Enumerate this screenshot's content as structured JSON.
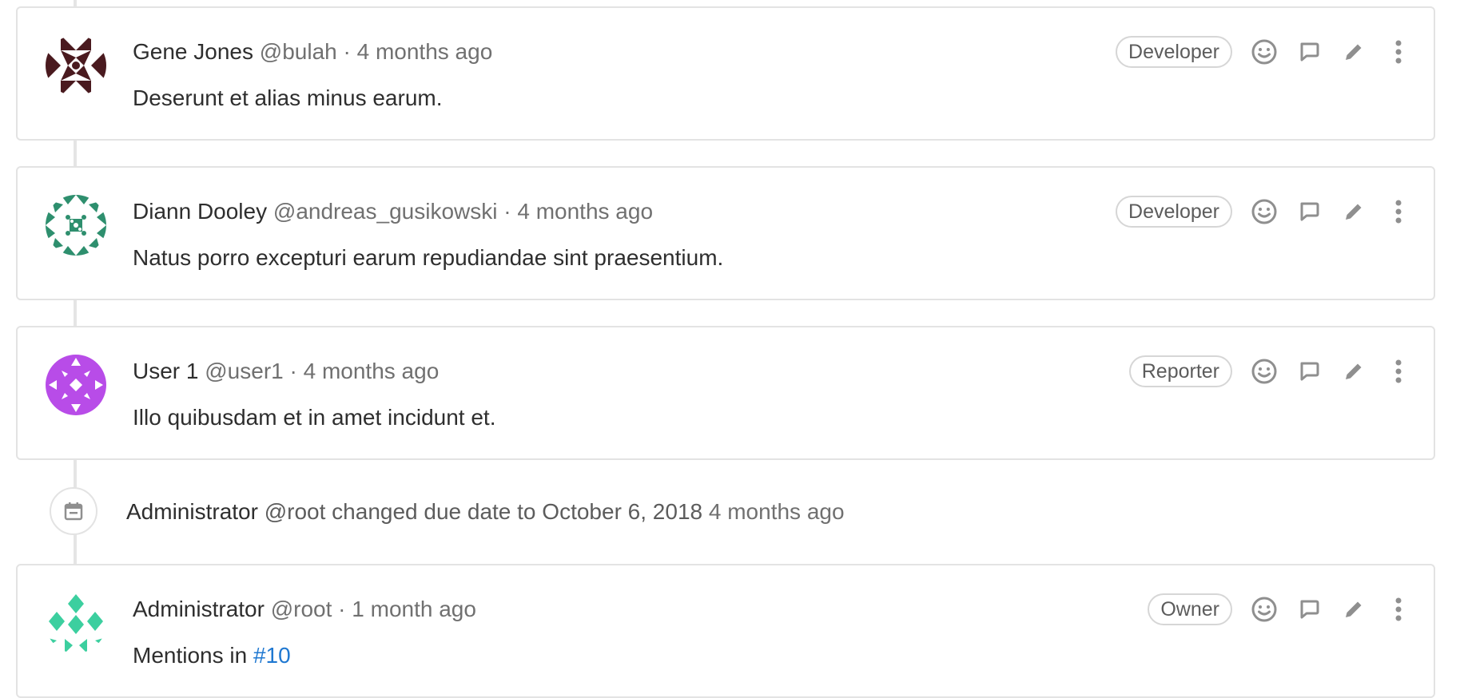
{
  "notes": [
    {
      "author": "Gene Jones",
      "handle": "@bulah",
      "separator": "·",
      "time": "4 months ago",
      "role": "Developer",
      "body": "Deserunt et alias minus earum.",
      "avatar_color": "#4a1a1f"
    },
    {
      "author": "Diann Dooley",
      "handle": "@andreas_gusikowski",
      "separator": "·",
      "time": "4 months ago",
      "role": "Developer",
      "body": "Natus porro excepturi earum repudiandae sint praesentium.",
      "avatar_color": "#2e8f6e"
    },
    {
      "author": "User 1",
      "handle": "@user1",
      "separator": "·",
      "time": "4 months ago",
      "role": "Reporter",
      "body": "Illo quibusdam et in amet incidunt et.",
      "avatar_color": "#b84ce8"
    },
    {
      "author": "Administrator",
      "handle": "@root",
      "separator": "·",
      "time": "1 month ago",
      "role": "Owner",
      "body_prefix": "Mentions in",
      "body_link": "#10",
      "avatar_color": "#3ccf9f"
    }
  ],
  "system_note": {
    "author": "Administrator",
    "handle": "@root",
    "action": "changed due date to October 6, 2018",
    "time": "4 months ago",
    "icon": "calendar-icon"
  },
  "actions": {
    "icons": [
      "smiley-icon",
      "comment-icon",
      "pencil-icon",
      "more-vertical-icon"
    ],
    "icon_color": "#8f8f8f"
  }
}
